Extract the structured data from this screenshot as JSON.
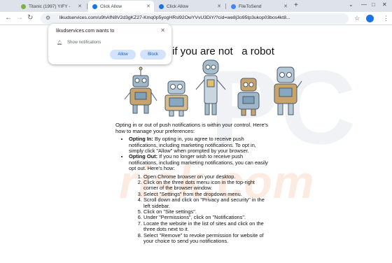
{
  "tabs": [
    {
      "label": "Titanic (1997) YIFY - ",
      "active": false
    },
    {
      "label": "Click Allow",
      "active": true
    },
    {
      "label": "Click Allow",
      "active": false
    },
    {
      "label": "FileToSend",
      "active": false
    }
  ],
  "address_bar": {
    "url": "likudservices.com/u9hAfN8V2d3gKZ27-Kmq0p5yogHRsl92OwYVvU3DiY/?cid=we8j3o95tp3ukop03bos4kt8..."
  },
  "popup": {
    "title": "likudservices.com wants to",
    "permission": "Show notifications",
    "allow_label": "Allow",
    "block_label": "Block"
  },
  "page": {
    "headline": "if you are not   a robot",
    "intro": "Opting in or out of push notifications is within your control. Here's how to manage your preferences:",
    "bullets": [
      {
        "term": "Opting In:",
        "text": " By opting in, you agree to receive push notifications, including marketing notifications. To opt in, simply click \"Allow\" when prompted by your browser."
      },
      {
        "term": "Opting Out:",
        "text": " If you no longer wish to receive push notifications, including marketing notifications, you can easily opt out. Here's how:"
      }
    ],
    "steps": [
      "Open Chrome browser on your desktop.",
      "Click on the three dots menu icon in the top-right corner of the browser window.",
      "Select \"Settings\" from the dropdown menu.",
      "Scroll down and click on \"Privacy and security\" in the left sidebar.",
      "Click on \"Site settings\".",
      "Under \"Permissions\", click on \"Notifications\".",
      "Locate the website in the list of sites and click on the three dots next to it.",
      "Select \"Remove\" to revoke permission for website of your choice to send you notifications."
    ],
    "watermark_top": "PC",
    "watermark_bottom": "risk.com"
  },
  "icons": {
    "tab_favicons": [
      "#7cb342",
      "#1a73e8",
      "#1a73e8",
      "#4285f4"
    ]
  }
}
